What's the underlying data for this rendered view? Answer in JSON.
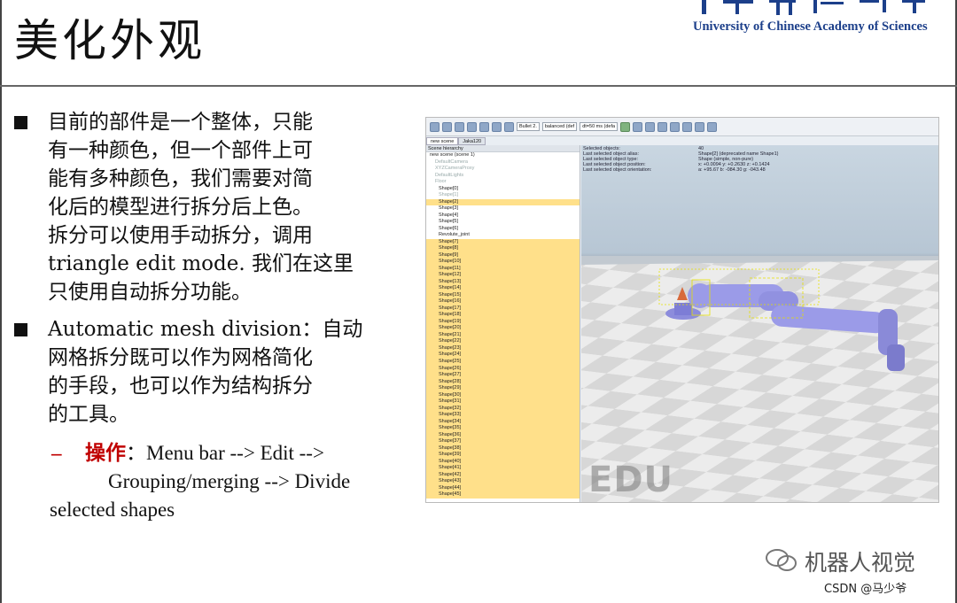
{
  "slide": {
    "title": "美化外观",
    "logo_text": "University of  Chinese Academy of Sciences"
  },
  "bullets": [
    {
      "lines": [
        "目前的部件是一个整体，只能",
        "有一种颜色，但一个部件上可",
        "能有多种颜色，我们需要对简",
        "化后的模型进行拆分后上色。",
        "拆分可以使用手动拆分，调用",
        "triangle edit mode. 我们在这里",
        "只使用自动拆分功能。"
      ]
    },
    {
      "lines": [
        "Automatic mesh division：自动",
        "网格拆分既可以作为网格简化",
        "的手段，也可以作为结构拆分",
        "的工具。"
      ]
    }
  ],
  "sub_bullet": {
    "dash": "–",
    "label": "操作",
    "line1": "：Menu bar --> Edit -->",
    "line2": "Grouping/merging --> Divide",
    "line3": "selected shapes"
  },
  "screenshot": {
    "toolbar": {
      "engine": "Bullet 2.",
      "mode": "balanced (def",
      "dt": "dt=50 ms (defa"
    },
    "tabs": [
      "new scene",
      "Jaka120"
    ],
    "hierarchy_title": "Scene hierarchy",
    "hierarchy": [
      {
        "label": "new scene (scene 1)",
        "kind": "root",
        "hl": false
      },
      {
        "label": "DefaultCamera",
        "kind": "gray",
        "hl": false
      },
      {
        "label": "XYZCameraProxy",
        "kind": "gray",
        "hl": false
      },
      {
        "label": "DefaultLights",
        "kind": "gray",
        "hl": false
      },
      {
        "label": "Floor",
        "kind": "gray",
        "hl": false
      },
      {
        "label": "Shape[0]",
        "kind": "n",
        "hl": false
      },
      {
        "label": "Shape[1]",
        "kind": "gray",
        "hl": false
      },
      {
        "label": "Shape[2]",
        "kind": "n",
        "hl": true
      },
      {
        "label": "Shape[3]",
        "kind": "n",
        "hl": false
      },
      {
        "label": "Shape[4]",
        "kind": "n",
        "hl": false
      },
      {
        "label": "Shape[5]",
        "kind": "n",
        "hl": false
      },
      {
        "label": "Shape[6]",
        "kind": "n",
        "hl": false
      },
      {
        "label": "Revolute_joint",
        "kind": "n",
        "hl": false
      },
      {
        "label": "Shape[7]",
        "kind": "n",
        "hl": true
      },
      {
        "label": "Shape[8]",
        "kind": "n",
        "hl": true
      },
      {
        "label": "Shape[9]",
        "kind": "n",
        "hl": true
      },
      {
        "label": "Shape[10]",
        "kind": "n",
        "hl": true
      },
      {
        "label": "Shape[11]",
        "kind": "n",
        "hl": true
      },
      {
        "label": "Shape[12]",
        "kind": "n",
        "hl": true
      },
      {
        "label": "Shape[13]",
        "kind": "n",
        "hl": true
      },
      {
        "label": "Shape[14]",
        "kind": "n",
        "hl": true
      },
      {
        "label": "Shape[15]",
        "kind": "n",
        "hl": true
      },
      {
        "label": "Shape[16]",
        "kind": "n",
        "hl": true
      },
      {
        "label": "Shape[17]",
        "kind": "n",
        "hl": true
      },
      {
        "label": "Shape[18]",
        "kind": "n",
        "hl": true
      },
      {
        "label": "Shape[19]",
        "kind": "n",
        "hl": true
      },
      {
        "label": "Shape[20]",
        "kind": "n",
        "hl": true
      },
      {
        "label": "Shape[21]",
        "kind": "n",
        "hl": true
      },
      {
        "label": "Shape[22]",
        "kind": "n",
        "hl": true
      },
      {
        "label": "Shape[23]",
        "kind": "n",
        "hl": true
      },
      {
        "label": "Shape[24]",
        "kind": "n",
        "hl": true
      },
      {
        "label": "Shape[25]",
        "kind": "n",
        "hl": true
      },
      {
        "label": "Shape[26]",
        "kind": "n",
        "hl": true
      },
      {
        "label": "Shape[27]",
        "kind": "n",
        "hl": true
      },
      {
        "label": "Shape[28]",
        "kind": "n",
        "hl": true
      },
      {
        "label": "Shape[29]",
        "kind": "n",
        "hl": true
      },
      {
        "label": "Shape[30]",
        "kind": "n",
        "hl": true
      },
      {
        "label": "Shape[31]",
        "kind": "n",
        "hl": true
      },
      {
        "label": "Shape[32]",
        "kind": "n",
        "hl": true
      },
      {
        "label": "Shape[33]",
        "kind": "n",
        "hl": true
      },
      {
        "label": "Shape[34]",
        "kind": "n",
        "hl": true
      },
      {
        "label": "Shape[35]",
        "kind": "n",
        "hl": true
      },
      {
        "label": "Shape[36]",
        "kind": "n",
        "hl": true
      },
      {
        "label": "Shape[37]",
        "kind": "n",
        "hl": true
      },
      {
        "label": "Shape[38]",
        "kind": "n",
        "hl": true
      },
      {
        "label": "Shape[39]",
        "kind": "n",
        "hl": true
      },
      {
        "label": "Shape[40]",
        "kind": "n",
        "hl": true
      },
      {
        "label": "Shape[41]",
        "kind": "n",
        "hl": true
      },
      {
        "label": "Shape[42]",
        "kind": "n",
        "hl": true
      },
      {
        "label": "Shape[43]",
        "kind": "n",
        "hl": true
      },
      {
        "label": "Shape[44]",
        "kind": "n",
        "hl": true
      },
      {
        "label": "Shape[45]",
        "kind": "n",
        "hl": true
      }
    ],
    "info": [
      {
        "k": "Selected objects:",
        "v": "40"
      },
      {
        "k": "Last selected object alias:",
        "v": "Shape[2]    (deprecated name Shape1)"
      },
      {
        "k": "Last selected object type:",
        "v": "Shape (simple, non-pure)"
      },
      {
        "k": "Last selected object position:",
        "v": "x: +0.0094   y: +0.2630   z: +0.1424"
      },
      {
        "k": "Last selected object orientation:",
        "v": "a: +95.67   b: -084.30   g: -043.48"
      }
    ],
    "watermark": "EDU"
  },
  "footer": {
    "account": "机器人视觉",
    "csdn": "CSDN @马少爷"
  },
  "colors": {
    "accent_red": "#c00000",
    "logo_blue": "#1c3f8a",
    "highlight": "#ffe08a",
    "robot": "#9b9be8"
  }
}
